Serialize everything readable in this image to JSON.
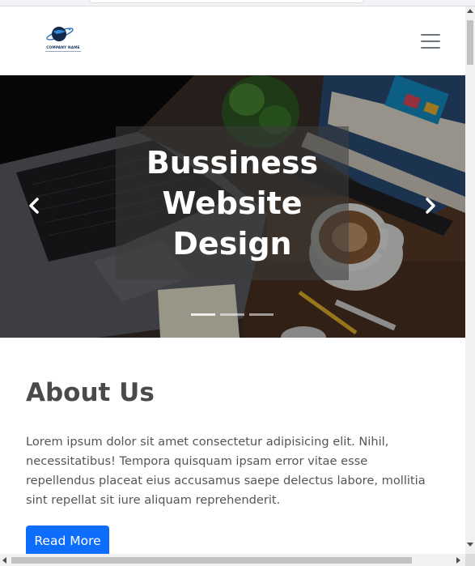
{
  "navbar": {
    "logo_text": "COMPANY NAME",
    "toggler_icon": "hamburger-menu-icon"
  },
  "hero": {
    "title": "Bussiness Website Design",
    "prev_icon": "chevron-left-icon",
    "next_icon": "chevron-right-icon",
    "slides_count": 3,
    "active_slide": 1
  },
  "about": {
    "heading": "About Us",
    "body": "Lorem ipsum dolor sit amet consectetur adipisicing elit. Nihil, necessitatibus! Tempora quisquam ipsam error vitae esse repellendus placeat eius accusamus saepe delectus labore, mollitia sint repellat sit iure aliquam reprehenderit.",
    "button_label": "Read More"
  },
  "colors": {
    "primary_button": "#0d6efd",
    "heading": "#4a4a4a",
    "body_text": "#555555"
  }
}
